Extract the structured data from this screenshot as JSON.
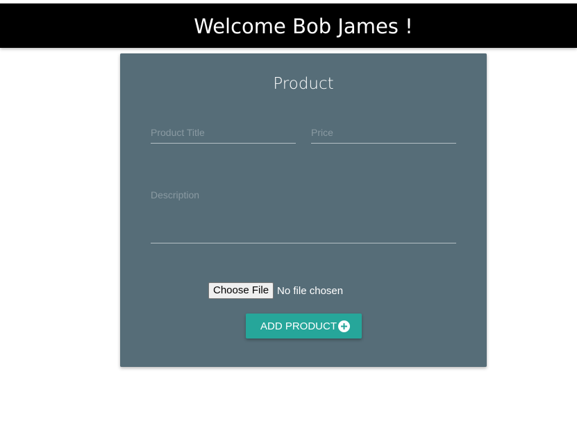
{
  "header": {
    "title": "Welcome Bob James !"
  },
  "form": {
    "title": "Product",
    "product_title_placeholder": "Product Title",
    "price_placeholder": "Price",
    "description_placeholder": "Description",
    "file_button_label": "Choose File",
    "file_status": "No file chosen",
    "submit_label": "ADD PRODUCT",
    "submit_icon": "add-circle-icon"
  },
  "colors": {
    "header_bg": "#000000",
    "card_bg": "#566d78",
    "button_bg": "#26a69a"
  }
}
